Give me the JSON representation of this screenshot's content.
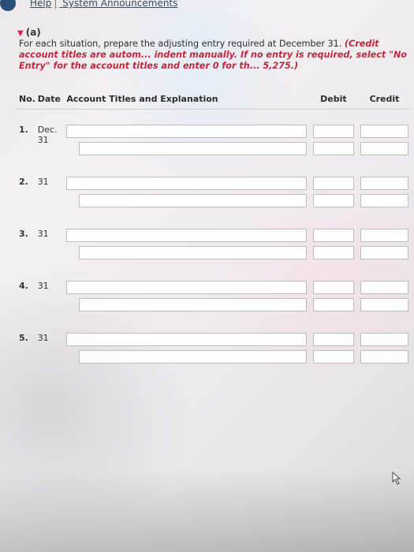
{
  "header": {
    "links": [
      "Help",
      "System Announcements"
    ],
    "separator": "|"
  },
  "section": {
    "label": "(a)"
  },
  "instructions": {
    "plain": "For each situation, prepare the adjusting entry required at December 31.",
    "emphasis": "(Credit account titles are autom... indent manually. If no entry is required, select \"No Entry\" for the account titles and enter 0 for th... 5,275.)"
  },
  "table": {
    "columns": {
      "no": "No.",
      "date": "Date",
      "account": "Account Titles and Explanation",
      "debit": "Debit",
      "credit": "Credit"
    },
    "rows": [
      {
        "no": "1.",
        "date": "Dec. 31"
      },
      {
        "no": "2.",
        "date": "31"
      },
      {
        "no": "3.",
        "date": "31"
      },
      {
        "no": "4.",
        "date": "31"
      },
      {
        "no": "5.",
        "date": "31"
      }
    ]
  },
  "icons": {
    "cursor": "hand-pointer-icon",
    "brand": "logo-mark"
  }
}
